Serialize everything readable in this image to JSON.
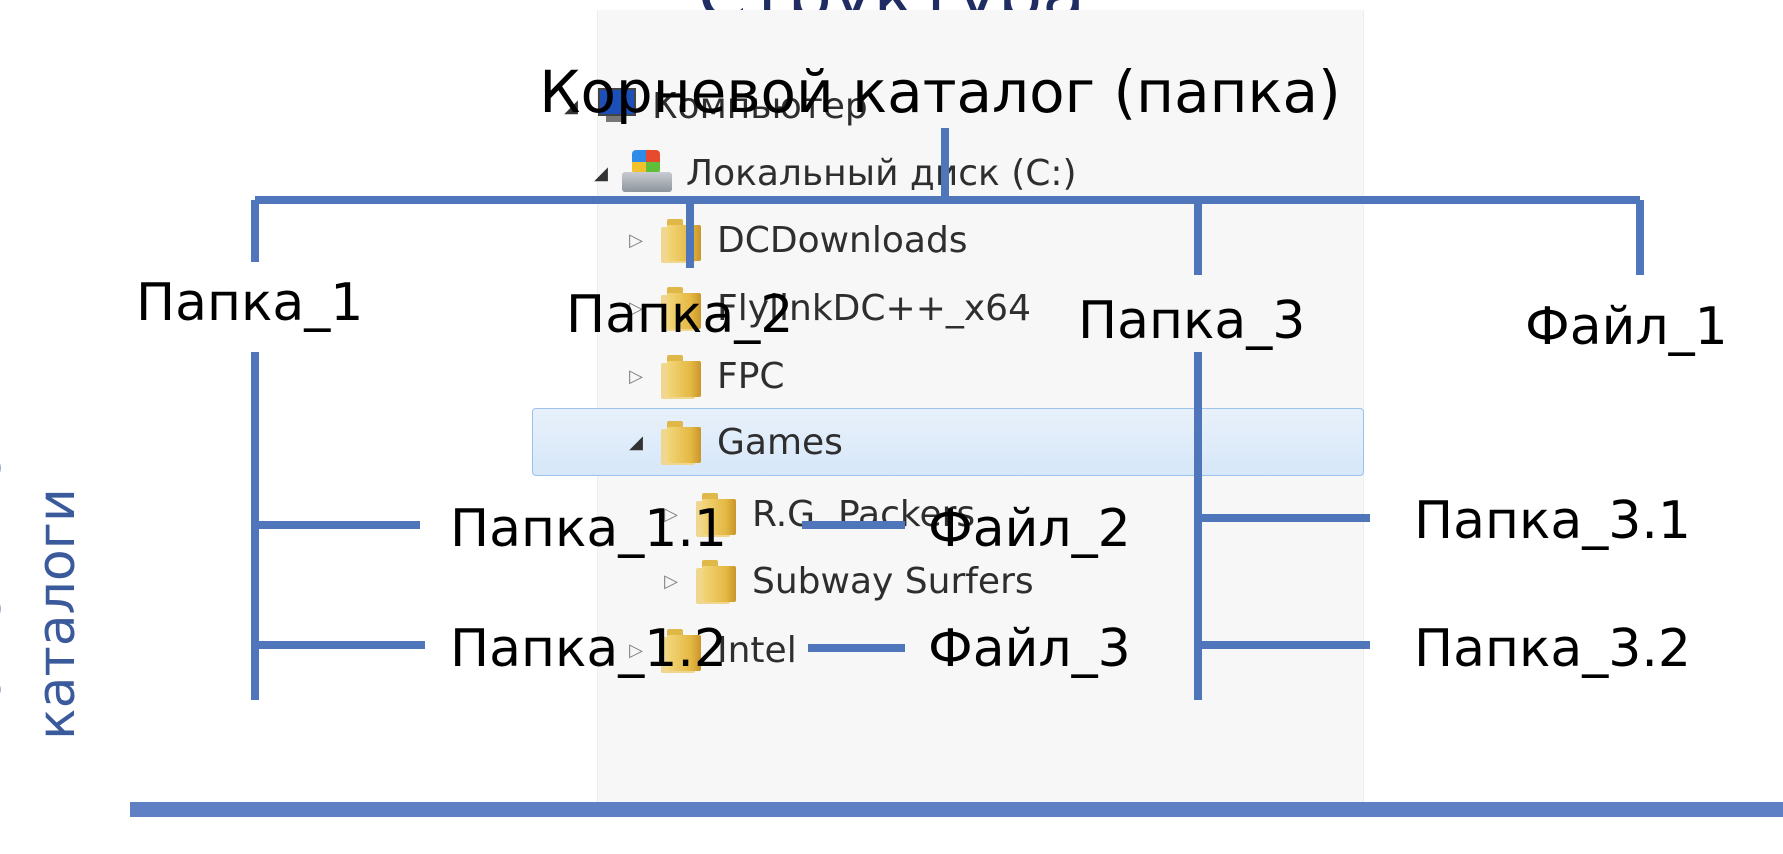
{
  "heading": "Структура",
  "root_label": "Корневой каталог (папка)",
  "side_caption": "Вложенные каталоги",
  "nodes": {
    "folder_1": "Папка_1",
    "folder_2": "Папка_2",
    "folder_3": "Папка_3",
    "file_1": "Файл_1",
    "folder_1_1": "Папка_1.1",
    "folder_1_2": "Папка_1.2",
    "file_2": "Файл_2",
    "file_3": "Файл_3",
    "folder_3_1": "Папка_3.1",
    "folder_3_2": "Папка_3.2"
  },
  "explorer": {
    "rows": [
      {
        "label": "Компьютер",
        "icon": "computer-icon",
        "expander": "◢"
      },
      {
        "label": "Локальный диск (C:)",
        "icon": "drive-icon",
        "expander": "◢"
      },
      {
        "label": "DCDownloads",
        "icon": "folder-icon",
        "expander": "▷"
      },
      {
        "label": "FlylinkDC++_x64",
        "icon": "folder-icon",
        "expander": "▷"
      },
      {
        "label": "FPC",
        "icon": "folder-icon",
        "expander": "▷"
      },
      {
        "label": "Games",
        "icon": "folder-icon",
        "expander": "◢"
      },
      {
        "label": "R.G. Packers",
        "icon": "folder-icon",
        "expander": "▷"
      },
      {
        "label": "Subway Surfers",
        "icon": "folder-icon",
        "expander": "▷"
      },
      {
        "label": "Intel",
        "icon": "folder-icon",
        "expander": "▷"
      }
    ]
  },
  "colors": {
    "connector": "#4f76bb",
    "heading": "#1f2d63",
    "caption": "#3a5a9b",
    "selection": "#d6e7f9"
  }
}
